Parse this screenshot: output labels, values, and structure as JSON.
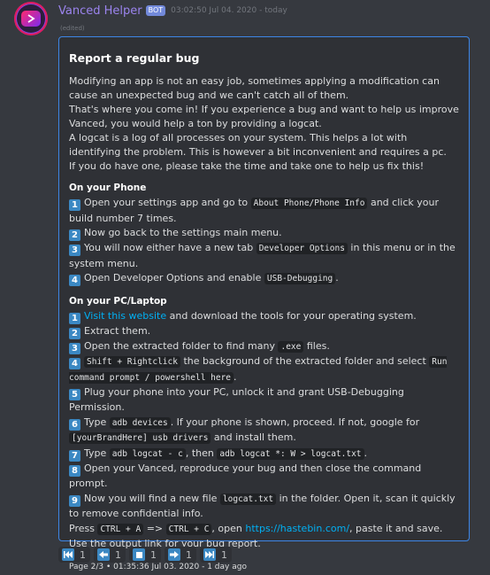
{
  "message": {
    "username": "Vanced Helper",
    "bot_tag": "BOT",
    "timestamp": "03:02:50 Jul 04. 2020 - today",
    "edited": "(edited)"
  },
  "embed": {
    "accent_color": "#3d86e6",
    "title": "Report a regular bug",
    "intro": [
      "Modifying an app is not an easy job, sometimes applying a modification can cause an unexpected bug and we can't catch all of them.",
      "That's where you come in! If you experience a bug and want to help us improve Vanced, you would help a ton by providing a logcat.",
      "A logcat is a log of all processes on your system. This helps a lot with identifying the problem. This is however a bit inconvenient and requires a pc.",
      "If you do have one, please take the time and take one to help us fix this!"
    ],
    "phone": {
      "heading": "On your Phone",
      "s1_num": "1",
      "s1_a": "Open your settings app and go to ",
      "s1_code": "About Phone/Phone Info",
      "s1_b": " and click your build number 7 times.",
      "s2_num": "2",
      "s2_a": "Now go back to the settings main menu.",
      "s3_num": "3",
      "s3_a": "You will now either have a new tab ",
      "s3_code": "Developer Options",
      "s3_b": " in this menu or in the system menu.",
      "s4_num": "4",
      "s4_a": "Open Developer Options and enable ",
      "s4_code": "USB-Debugging",
      "s4_b": "."
    },
    "pc": {
      "heading": "On your PC/Laptop",
      "s1_num": "1",
      "s1_link": "Visit this website",
      "s1_b": " and download the tools for your operating system.",
      "s2_num": "2",
      "s2_a": "Extract them.",
      "s3_num": "3",
      "s3_a": "Open the extracted folder to find many ",
      "s3_code": ".exe",
      "s3_b": " files.",
      "s4_num": "4",
      "s4_code": "Shift + Rightclick",
      "s4_b": " the background of the extracted folder and select ",
      "s4_code2": "Run command prompt / powershell here",
      "s4_c": ".",
      "s5_num": "5",
      "s5_a": "Plug your phone into your PC, unlock it and grant USB-Debugging Permission.",
      "s6_num": "6",
      "s6_a": "Type ",
      "s6_code": "adb devices",
      "s6_b": ". If your phone is shown, proceed. If not, google for ",
      "s6_code2": "[yourBrandHere] usb drivers",
      "s6_c": " and install them.",
      "s7_num": "7",
      "s7_a": "Type ",
      "s7_code": "adb logcat - c",
      "s7_b": ", then ",
      "s7_code2": "adb logcat *: W > logcat.txt",
      "s7_c": ".",
      "s8_num": "8",
      "s8_a": "Open your Vanced, reproduce your bug and then close the command prompt.",
      "s9_num": "9",
      "s9_a": "Now you will find a new file ",
      "s9_code": "logcat.txt",
      "s9_b": " in the folder. Open it, scan it quickly to remove confidential info.",
      "press_a": "Press ",
      "press_code1": "CTRL + A",
      "press_arrow": " => ",
      "press_code2": "CTRL + C",
      "press_b": ", open ",
      "press_link": "https://hastebin.com/",
      "press_c": ", paste it and save. Use the output link for your bug report."
    },
    "footer": "Page 2/3 • 01:35:36 Jul 03. 2020 - 1 day ago"
  },
  "reactions": [
    {
      "icon": "first-page-icon",
      "count": "1"
    },
    {
      "icon": "previous-page-icon",
      "count": "1"
    },
    {
      "icon": "stop-icon",
      "count": "1"
    },
    {
      "icon": "next-page-icon",
      "count": "1"
    },
    {
      "icon": "last-page-icon",
      "count": "1"
    }
  ]
}
